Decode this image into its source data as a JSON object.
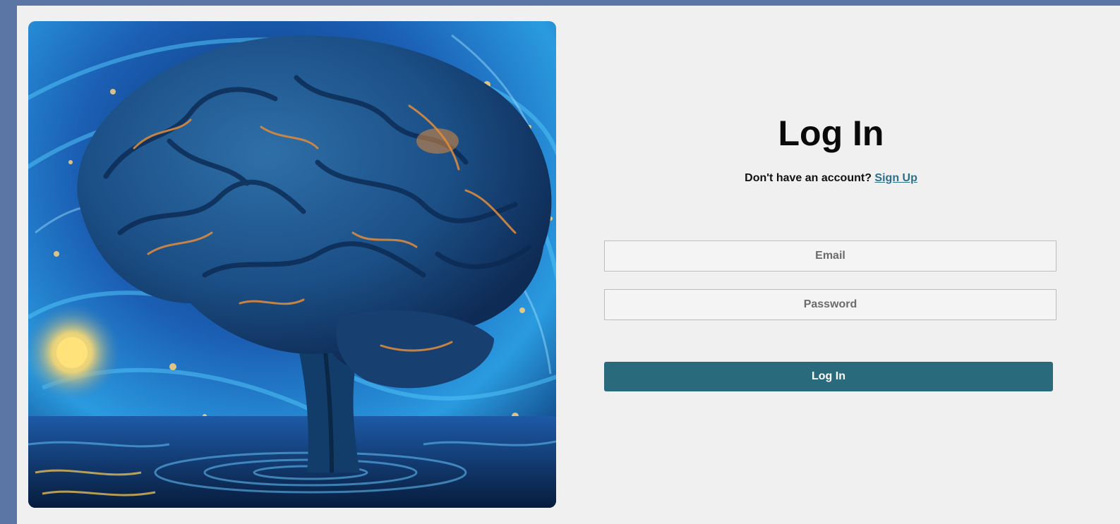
{
  "login": {
    "title": "Log In",
    "signup_prompt": "Don't have an account?",
    "signup_link": "Sign Up",
    "email_placeholder": "Email",
    "password_placeholder": "Password",
    "submit_label": "Log In"
  },
  "colors": {
    "background": "#5b76a4",
    "panel": "#f0f0f0",
    "button": "#2a6a7d",
    "link": "#2a6f8c"
  }
}
